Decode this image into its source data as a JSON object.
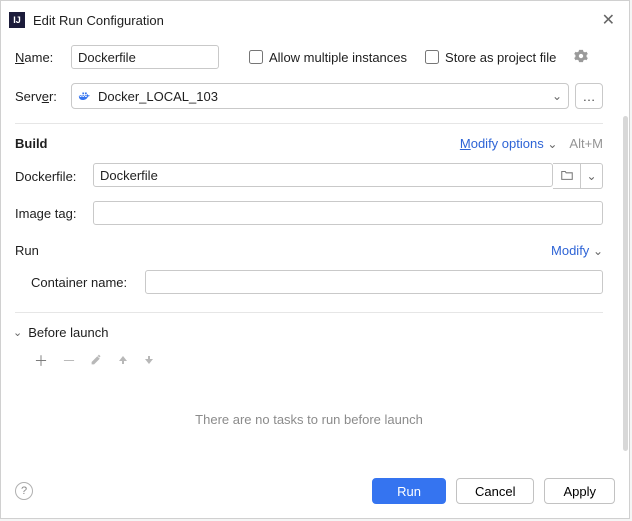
{
  "title": "Edit Run Configuration",
  "nameLabel": {
    "pre": "",
    "u": "N",
    "post": "ame:"
  },
  "name": "Dockerfile",
  "allowMultiple": {
    "pre": "Allow m",
    "u": "u",
    "post": "ltiple instances"
  },
  "storeProject": {
    "pre": "",
    "u": "S",
    "post": "tore as project file"
  },
  "serverLabel": {
    "pre": "Serv",
    "u": "e",
    "post": "r:"
  },
  "server": "Docker_LOCAL_103",
  "build": {
    "title": "Build",
    "modify": {
      "pre": "",
      "u": "M",
      "post": "odify options"
    },
    "hint": "Alt+M",
    "dockerfileLabel": "Dockerfile:",
    "dockerfile": "Dockerfile",
    "imageTagLabel": "Image tag:",
    "imageTag": ""
  },
  "run": {
    "title": "Run",
    "modify": "Modify",
    "containerNameLabel": "Container name:",
    "containerName": ""
  },
  "beforeLaunch": {
    "pre": "",
    "u": "B",
    "post": "efore launch"
  },
  "emptyMsg": "There are no tasks to run before launch",
  "buttons": {
    "run": "Run",
    "cancel": "Cancel",
    "apply": "Apply"
  }
}
